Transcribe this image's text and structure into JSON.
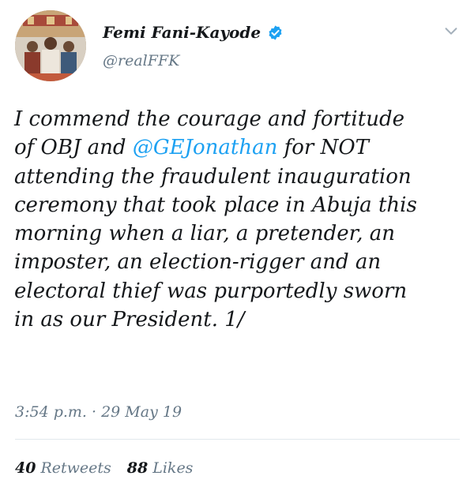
{
  "author": {
    "display_name": "Femi Fani-Kayode",
    "handle": "@realFFK",
    "verified": true,
    "avatar_icon": "profile-photo"
  },
  "tweet": {
    "lines": [
      {
        "segments": [
          {
            "text": "I commend the courage and fortitude",
            "mention": false
          }
        ]
      },
      {
        "segments": [
          {
            "text": "of OBJ and ",
            "mention": false
          },
          {
            "text": "@GEJonathan",
            "mention": true
          },
          {
            "text": " for NOT",
            "mention": false
          }
        ]
      },
      {
        "segments": [
          {
            "text": "attending the fraudulent inauguration",
            "mention": false
          }
        ]
      },
      {
        "segments": [
          {
            "text": "ceremony that took place in Abuja this",
            "mention": false
          }
        ]
      },
      {
        "segments": [
          {
            "text": "morning when a liar, a pretender, an",
            "mention": false
          }
        ]
      },
      {
        "segments": [
          {
            "text": "imposter, an election-rigger and an",
            "mention": false
          }
        ]
      },
      {
        "segments": [
          {
            "text": "electoral thief was purportedly sworn",
            "mention": false
          }
        ]
      },
      {
        "segments": [
          {
            "text": "in as our President. 1/",
            "mention": false
          }
        ]
      }
    ],
    "timestamp": "3:54 p.m. · 29 May 19"
  },
  "stats": {
    "retweets_count": "40",
    "retweets_label": "Retweets",
    "likes_count": "88",
    "likes_label": "Likes"
  },
  "icons": {
    "verified": "verified-badge-icon",
    "menu": "chevron-down-icon"
  },
  "colors": {
    "link": "#1da1f2",
    "text": "#14171a",
    "secondary": "#657786",
    "divider": "#e1e8ed"
  }
}
